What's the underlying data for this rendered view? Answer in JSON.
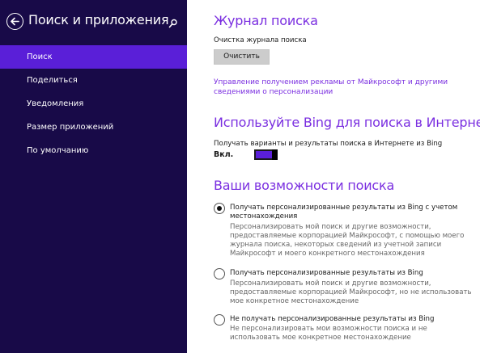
{
  "sidebar": {
    "title": "Поиск и приложения",
    "items": [
      {
        "label": "Поиск",
        "active": true
      },
      {
        "label": "Поделиться"
      },
      {
        "label": "Уведомления"
      },
      {
        "label": "Размер приложений"
      },
      {
        "label": "По умолчанию"
      }
    ],
    "bg_color": "#180a48",
    "active_color": "#5a1fd8"
  },
  "history": {
    "title": "Журнал поиска",
    "clear_label": "Очистка журнала поиска",
    "clear_button": "Очистить",
    "ads_link": "Управление получением рекламы от Майкрософт и другими сведениями о персонализации"
  },
  "bing": {
    "title": "Используйте Bing для поиска в Интернете",
    "suggestions_label": "Получать варианты и результаты поиска в Интернете из Bing",
    "toggle_state": "Вкл.",
    "toggle_on": true
  },
  "experience": {
    "title": "Ваши возможности поиска",
    "options": [
      {
        "title": "Получать персонализированные результаты из Bing с учетом местонахождения",
        "desc": "Персонализировать мой поиск и другие возможности, предоставляемые корпорацией Майкрософт, с помощью моего журнала поиска, некоторых сведений из учетной записи Майкрософт и моего конкретного местонахождения",
        "checked": true
      },
      {
        "title": "Получать персонализированные результаты из Bing",
        "desc": "Персонализировать мой поиск и другие возможности, предоставляемые корпорацией Майкрософт, но не использовать мое конкретное местонахождение",
        "checked": false
      },
      {
        "title": "Не получать персонализированные результаты из Bing",
        "desc": "Не персонализировать мои возможности поиска и не использовать мое конкретное местонахождение",
        "checked": false
      }
    ]
  },
  "accent_color": "#7a2ee0",
  "icons": {
    "back": "back-arrow-icon",
    "search": "search-icon"
  }
}
